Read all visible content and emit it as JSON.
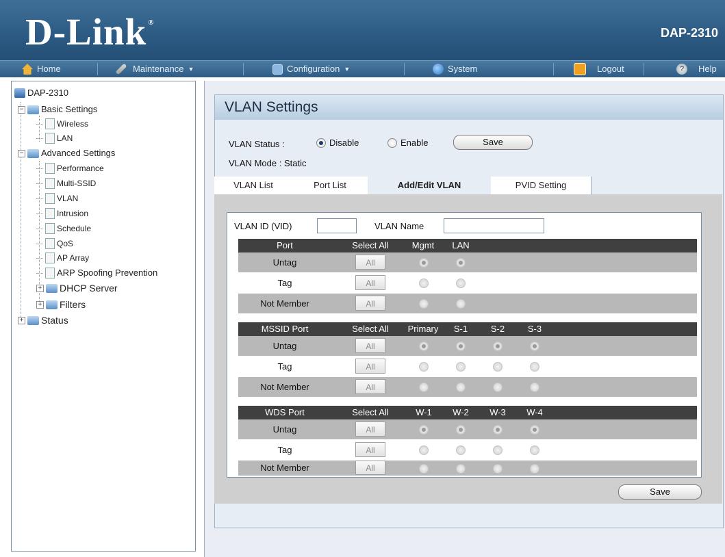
{
  "header": {
    "logo": "D-Link",
    "logo_reg": "®",
    "model": "DAP-2310"
  },
  "menu": {
    "home": "Home",
    "maintenance": "Maintenance",
    "configuration": "Configuration",
    "system": "System",
    "logout": "Logout",
    "help": "Help"
  },
  "sidebar": {
    "root": "DAP-2310",
    "basic": "Basic Settings",
    "basic_items": [
      "Wireless",
      "LAN"
    ],
    "advanced": "Advanced Settings",
    "advanced_items": [
      "Performance",
      "Multi-SSID",
      "VLAN",
      "Intrusion",
      "Schedule",
      "QoS",
      "AP Array",
      "ARP Spoofing Prevention"
    ],
    "dhcp": "DHCP Server",
    "filters": "Filters",
    "status": "Status"
  },
  "page": {
    "title": "VLAN Settings",
    "status_label": "VLAN Status",
    "colon": ":",
    "disable": "Disable",
    "enable": "Enable",
    "save": "Save",
    "mode_label": "VLAN Mode",
    "mode_value": "Static"
  },
  "tabs": [
    "VLAN List",
    "Port List",
    "Add/Edit VLAN",
    "PVID Setting"
  ],
  "form": {
    "vid_label": "VLAN ID (VID)",
    "name_label": "VLAN Name"
  },
  "grid": {
    "all_label": "All",
    "row_labels": [
      "Untag",
      "Tag",
      "Not Member"
    ],
    "sections": [
      {
        "headers": [
          "Port",
          "Select All",
          "Mgmt",
          "LAN"
        ]
      },
      {
        "headers": [
          "MSSID Port",
          "Select All",
          "Primary",
          "S-1",
          "S-2",
          "S-3"
        ]
      },
      {
        "headers": [
          "WDS Port",
          "Select All",
          "W-1",
          "W-2",
          "W-3",
          "W-4"
        ]
      }
    ]
  },
  "bottom_save": "Save"
}
